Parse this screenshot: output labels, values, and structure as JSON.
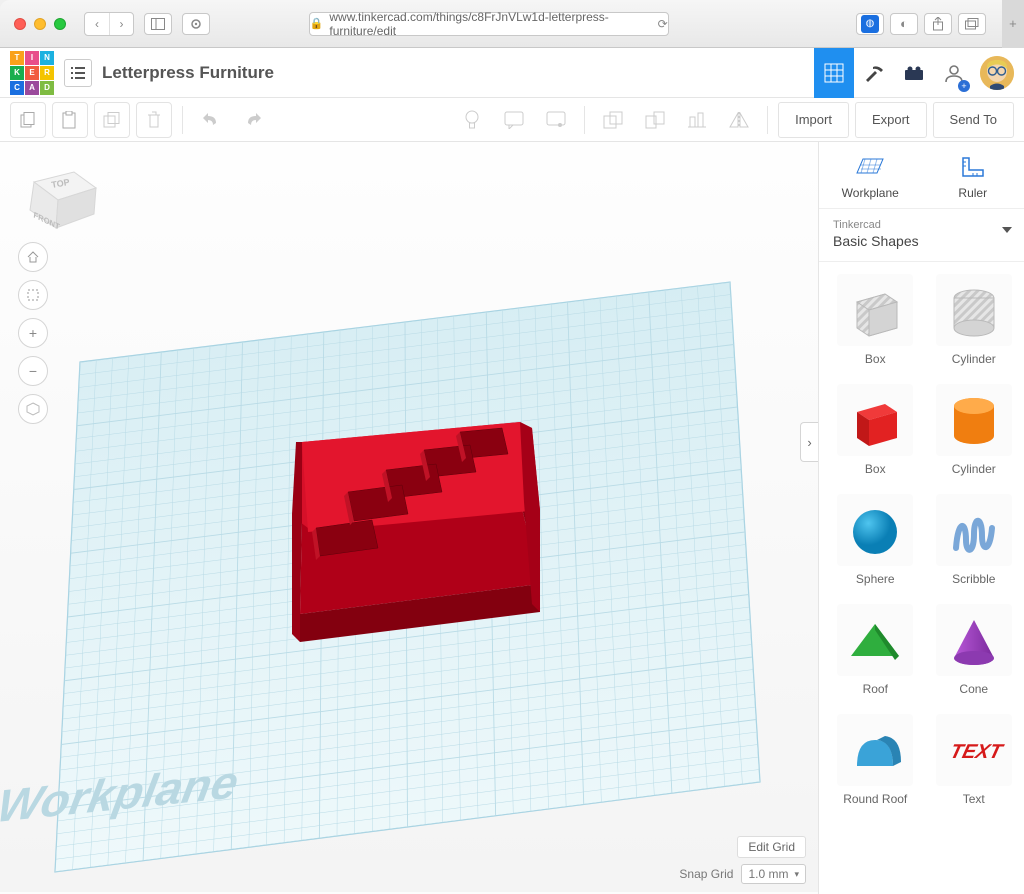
{
  "browser": {
    "url": "www.tinkercad.com/things/c8FrJnVLw1d-letterpress-furniture/edit"
  },
  "header": {
    "title": "Letterpress Furniture"
  },
  "actions": {
    "import": "Import",
    "export": "Export",
    "send_to": "Send To"
  },
  "right_panel": {
    "workplane": "Workplane",
    "ruler": "Ruler",
    "category_sub": "Tinkercad",
    "category": "Basic Shapes",
    "shapes": [
      {
        "label": "Box",
        "kind": "box-striped"
      },
      {
        "label": "Cylinder",
        "kind": "cyl-striped"
      },
      {
        "label": "Box",
        "kind": "box-red"
      },
      {
        "label": "Cylinder",
        "kind": "cyl-orange"
      },
      {
        "label": "Sphere",
        "kind": "sphere-blue"
      },
      {
        "label": "Scribble",
        "kind": "scribble"
      },
      {
        "label": "Roof",
        "kind": "roof-green"
      },
      {
        "label": "Cone",
        "kind": "cone-purple"
      },
      {
        "label": "Round Roof",
        "kind": "rroof-blue"
      },
      {
        "label": "Text",
        "kind": "text-red"
      }
    ]
  },
  "canvas": {
    "workplane_label": "Workplane",
    "edit_grid": "Edit Grid",
    "snap_label": "Snap Grid",
    "snap_value": "1.0 mm"
  },
  "viewcube": {
    "top": "TOP",
    "front": "FRONT"
  }
}
